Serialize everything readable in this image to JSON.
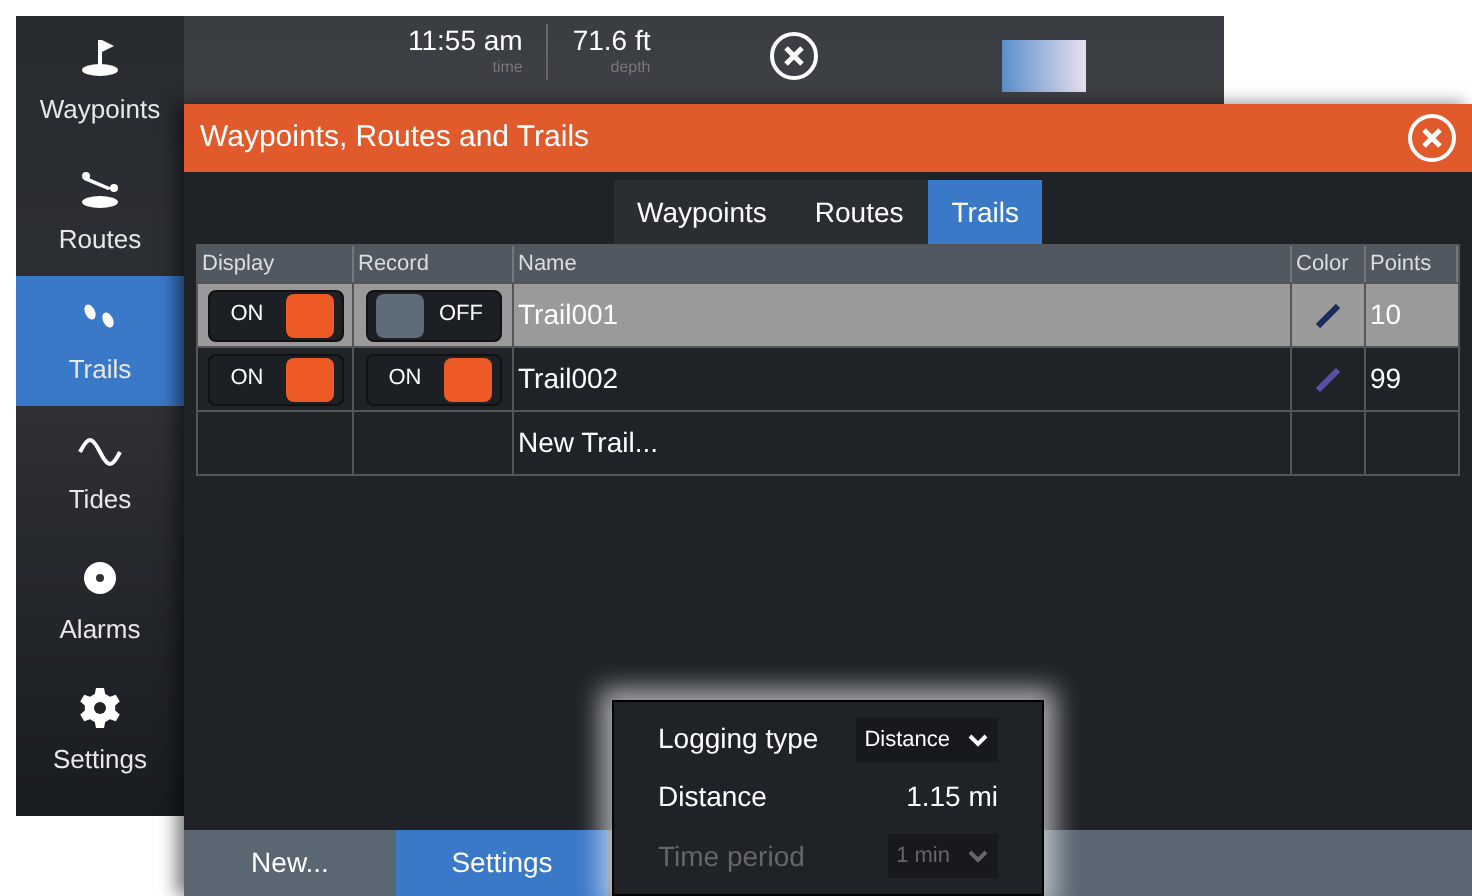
{
  "sidebar": {
    "items": [
      {
        "kind": "waypoint",
        "label": "Waypoints",
        "selected": false
      },
      {
        "kind": "route",
        "label": "Routes",
        "selected": false
      },
      {
        "kind": "trail",
        "label": "Trails",
        "selected": true
      },
      {
        "kind": "tide",
        "label": "Tides",
        "selected": false
      },
      {
        "kind": "alarm",
        "label": "Alarms",
        "selected": false
      },
      {
        "kind": "settings",
        "label": "Settings",
        "selected": false
      }
    ]
  },
  "top_bar": {
    "readouts": [
      {
        "value": "11:55 am",
        "caption": "time"
      },
      {
        "value": "71.6 ft",
        "caption": "depth"
      }
    ]
  },
  "dialog": {
    "title": "Waypoints, Routes and Trails",
    "tabs": [
      {
        "label": "Waypoints",
        "selected": false
      },
      {
        "label": "Routes",
        "selected": false
      },
      {
        "label": "Trails",
        "selected": true
      }
    ],
    "table": {
      "columns": [
        "Display",
        "Record",
        "Name",
        "Color",
        "Points"
      ],
      "rows": [
        {
          "display": {
            "label": "ON",
            "on": true
          },
          "record": {
            "label": "OFF",
            "on": false
          },
          "name": "Trail001",
          "color": "#1b2d5c",
          "points": "10",
          "selected": true
        },
        {
          "display": {
            "label": "ON",
            "on": true
          },
          "record": {
            "label": "ON",
            "on": true
          },
          "name": "Trail002",
          "color": "#5b4fa8",
          "points": "99",
          "selected": false
        }
      ],
      "new_row": "New Trail..."
    },
    "buttons": [
      {
        "label": "New...",
        "selected": false
      },
      {
        "label": "Settings",
        "selected": true
      }
    ],
    "settings_popup": {
      "rows": [
        {
          "kind": "select",
          "label": "Logging type",
          "value": "Distance",
          "disabled": false
        },
        {
          "kind": "value",
          "label": "Distance",
          "value": "1.15 mi",
          "disabled": false
        },
        {
          "kind": "select",
          "label": "Time period",
          "value": "1 min",
          "disabled": true
        }
      ]
    }
  }
}
